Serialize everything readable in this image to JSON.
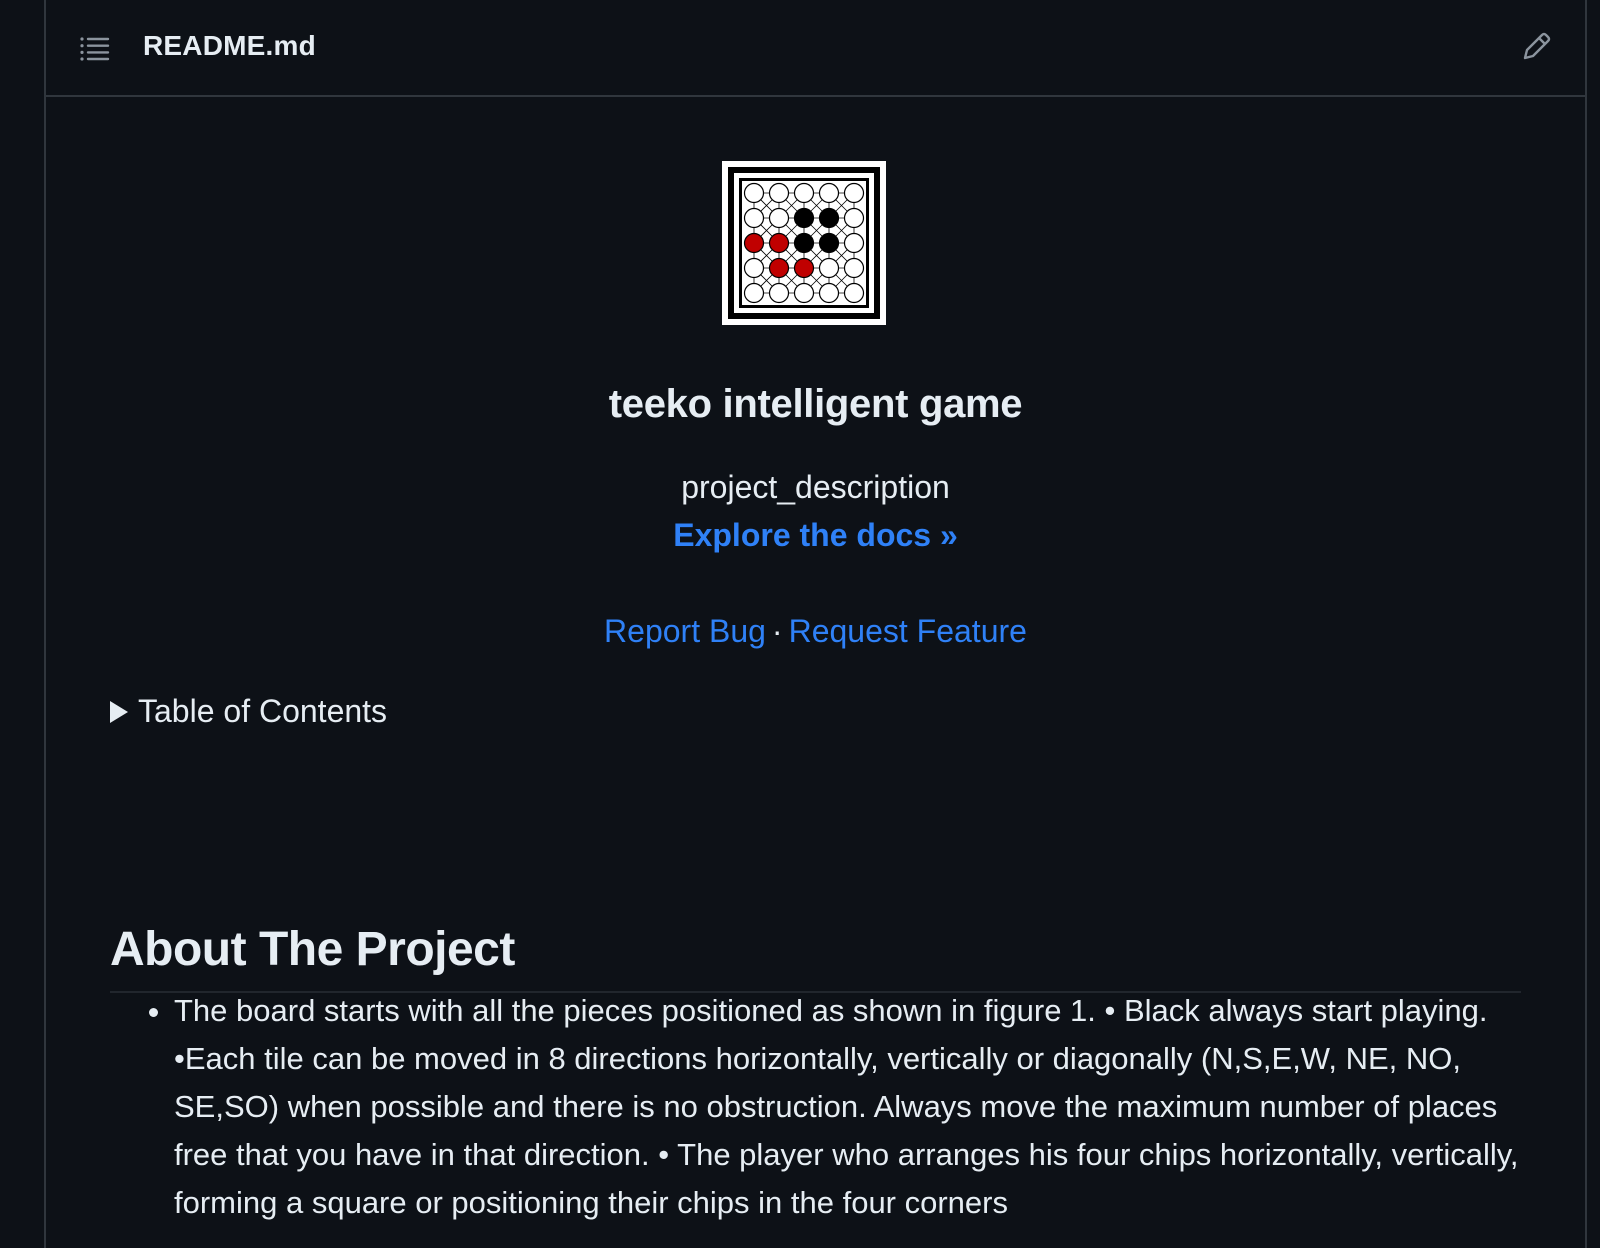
{
  "file_header": {
    "file_name": "README.md",
    "toc_icon": "list-icon",
    "edit_icon": "pencil-icon"
  },
  "readme": {
    "logo_alt": "teeko board logo",
    "title": "teeko intelligent game",
    "description": "project_description",
    "explore_link": "Explore the docs »",
    "report_bug": "Report Bug",
    "separator": "·",
    "request_feature": "Request Feature",
    "toc_label": "Table of Contents",
    "about_heading": "About The Project",
    "about_items": [
      "The board starts with all the pieces positioned as shown in figure 1. • Black always start playing. •Each tile can be moved in 8 directions horizontally, vertically or diagonally (N,S,E,W, NE, NO, SE,SO) when possible and there is no obstruction. Always move the maximum number of places free that you have in that direction. • The player who arranges his four chips horizontally, vertically, forming a square or positioning their chips in the four corners"
    ]
  },
  "colors": {
    "background": "#0d1117",
    "border": "#30363d",
    "text": "#e6edf3",
    "link": "#2f81f7",
    "red_piece": "#c00000",
    "black_piece": "#000000"
  }
}
